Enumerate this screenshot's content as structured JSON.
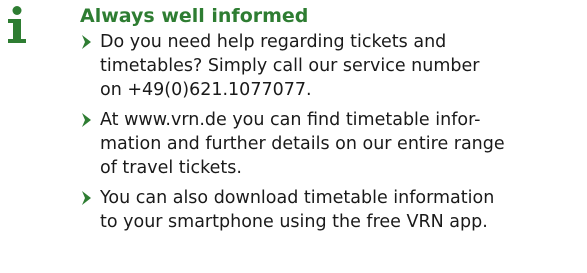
{
  "section": {
    "icon": "info-icon",
    "accent_color": "#2e7d32",
    "heading": "Always well informed",
    "items": [
      {
        "lines": [
          "Do you need help regarding tickets and",
          "timetables? Simply call our service number",
          "on +49(0)621.1077077."
        ]
      },
      {
        "lines": [
          "At www.vrn.de you can find timetable infor-",
          "mation and further details on our entire range",
          "of travel tickets."
        ]
      },
      {
        "lines": [
          "You can also download timetable information",
          "to your smartphone using the free VRN app."
        ]
      }
    ]
  }
}
